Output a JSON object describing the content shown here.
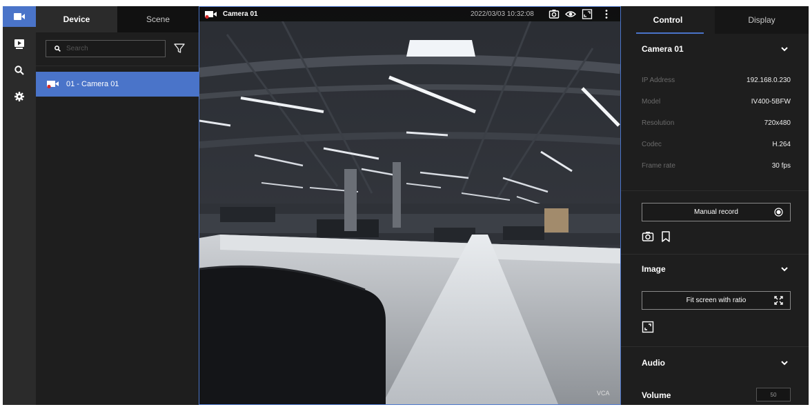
{
  "rail": {
    "items": [
      {
        "icon": "video-camera-icon",
        "active": true
      },
      {
        "icon": "playback-icon",
        "active": false
      },
      {
        "icon": "search-icon",
        "active": false
      },
      {
        "icon": "gear-icon",
        "active": false
      }
    ]
  },
  "device_panel": {
    "tabs": [
      {
        "label": "Device",
        "active": true
      },
      {
        "label": "Scene",
        "active": false
      }
    ],
    "search": {
      "placeholder": "Search",
      "value": ""
    },
    "devices": [
      {
        "label": "01 - Camera 01",
        "selected": true
      }
    ]
  },
  "viewer": {
    "title": "Camera 01",
    "timestamp": "2022/03/03 10:32:08",
    "overlay_label": "VCA",
    "toolbar_icons": [
      "snapshot-icon",
      "eye-icon",
      "fit-screen-icon",
      "more-vert-icon"
    ]
  },
  "right_panel": {
    "tabs": [
      {
        "label": "Control",
        "active": true
      },
      {
        "label": "Display",
        "active": false
      }
    ],
    "camera_section": {
      "title": "Camera 01",
      "rows": [
        {
          "label": "IP Address",
          "value": "192.168.0.230"
        },
        {
          "label": "Model",
          "value": "IV400-5BFW"
        },
        {
          "label": "Resolution",
          "value": "720x480"
        },
        {
          "label": "Codec",
          "value": "H.264"
        },
        {
          "label": "Frame rate",
          "value": "30 fps"
        }
      ]
    },
    "record": {
      "label": "Manual record"
    },
    "image_section": {
      "title": "Image",
      "fit_label": "Fit screen with ratio"
    },
    "audio_section": {
      "title": "Audio",
      "volume_label": "Volume",
      "volume_value": "50"
    }
  },
  "colors": {
    "accent": "#4a74c9",
    "background": "#1a1a1a",
    "record_red": "#d62a2a"
  }
}
